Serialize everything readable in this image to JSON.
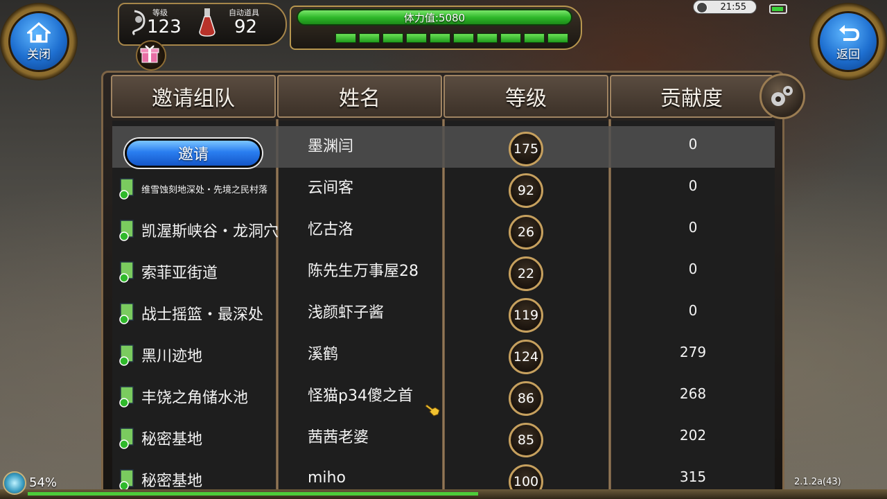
{
  "hud": {
    "close_label": "关闭",
    "back_label": "返回",
    "level_label": "等级",
    "level_value": "123",
    "auto_item_label": "自动道具",
    "auto_item_value": "92",
    "stamina_text": "体力值:5080",
    "time": "21:55"
  },
  "table": {
    "headers": [
      "邀请组队",
      "姓名",
      "等级",
      "贡献度"
    ],
    "invite_label": "邀请",
    "rows": [
      {
        "location": "",
        "name": "墨渊闫",
        "level": "175",
        "contribution": "0"
      },
      {
        "location": "维雪蚀刻地深处・先境之民村落",
        "name": "云间客",
        "level": "92",
        "contribution": "0"
      },
      {
        "location": "凯渥斯峡谷・龙洞穴",
        "name": "忆古洛",
        "level": "26",
        "contribution": "0"
      },
      {
        "location": "索菲亚街道",
        "name": "陈先生万事屋28",
        "level": "22",
        "contribution": "0"
      },
      {
        "location": "战士摇篮・最深处",
        "name": "浅颜虾子酱",
        "level": "119",
        "contribution": "0"
      },
      {
        "location": "黑川迹地",
        "name": "溪鹤",
        "level": "124",
        "contribution": "279"
      },
      {
        "location": "丰饶之角储水池",
        "name": "怪猫p34傻之首",
        "level": "86",
        "contribution": "268"
      },
      {
        "location": "秘密基地",
        "name": "茜茜老婆",
        "level": "85",
        "contribution": "202"
      },
      {
        "location": "秘密基地",
        "name": "miho",
        "level": "100",
        "contribution": "315"
      }
    ]
  },
  "footer": {
    "signal_percent": "54%",
    "version": "2.1.2a(43)"
  },
  "colors": {
    "accent_gold": "#c6a05e",
    "stamina_green": "#2fb92b",
    "invite_blue": "#2a7ef0"
  }
}
